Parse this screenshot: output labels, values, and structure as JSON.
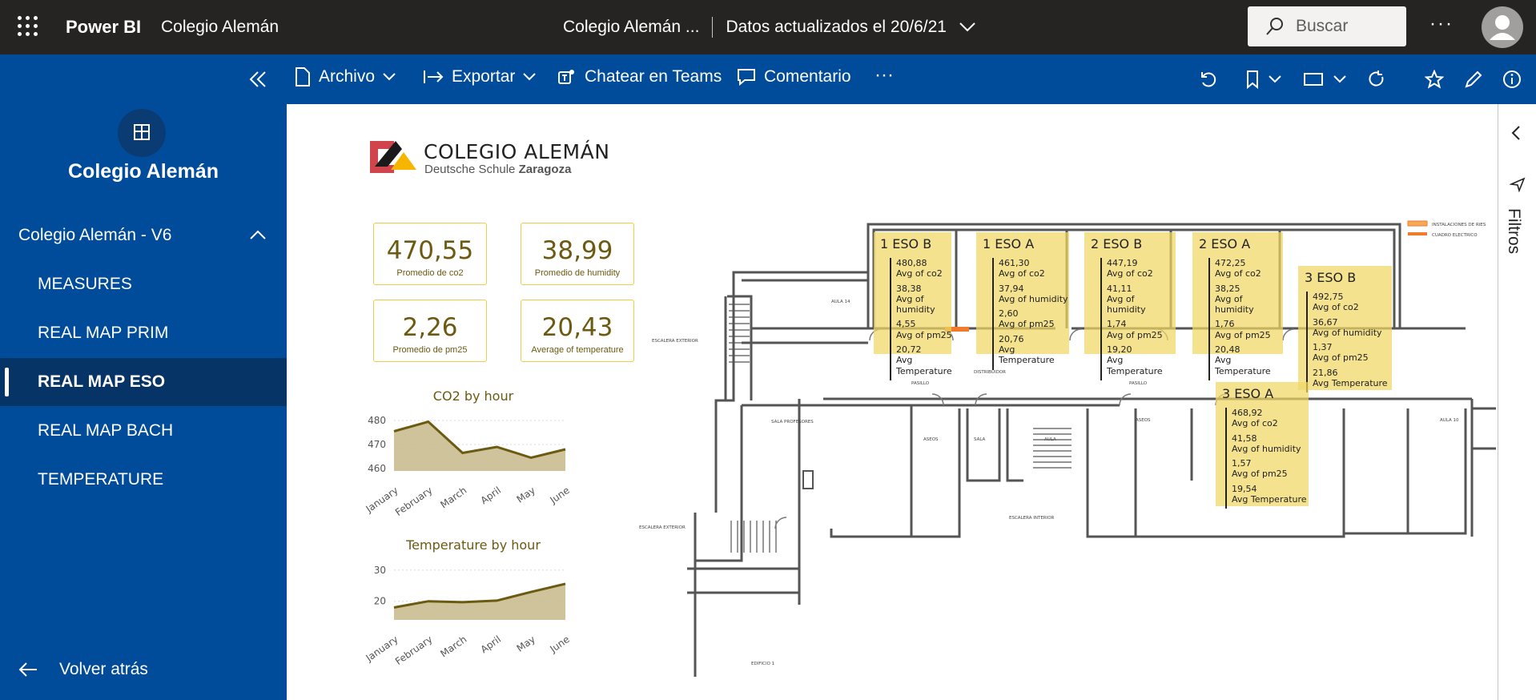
{
  "topbar": {
    "brand": "Power BI",
    "workspace": "Colegio Alemán",
    "report_title": "Colegio Alemán ...",
    "updated": "Datos actualizados el 20/6/21",
    "search_placeholder": "Buscar",
    "more": "···"
  },
  "toolbar": {
    "archivo": "Archivo",
    "exportar": "Exportar",
    "teams": "Chatear en Teams",
    "comentario": "Comentario",
    "more": "···"
  },
  "sidebar": {
    "workspace_title": "Colegio Alemán",
    "app_name": "Colegio Alemán - V6",
    "items": [
      {
        "label": "MEASURES"
      },
      {
        "label": "REAL MAP PRIM"
      },
      {
        "label": "REAL MAP ESO"
      },
      {
        "label": "REAL MAP BACH"
      },
      {
        "label": "TEMPERATURE"
      }
    ],
    "active_index": 2,
    "back": "Volver atrás"
  },
  "right_pane": {
    "filters": "Filtros"
  },
  "logo": {
    "line1": "COLEGIO ALEMÁN",
    "line2a": "Deutsche Schule",
    "line2b": "Zaragoza"
  },
  "cards": [
    {
      "value": "470,55",
      "label": "Promedio de co2"
    },
    {
      "value": "38,99",
      "label": "Promedio de humidity"
    },
    {
      "value": "2,26",
      "label": "Promedio de pm25"
    },
    {
      "value": "20,43",
      "label": "Average of temperature"
    }
  ],
  "chart_data": [
    {
      "type": "area",
      "title": "CO2 by hour",
      "categories": [
        "January",
        "February",
        "March",
        "April",
        "May",
        "June"
      ],
      "series": [
        {
          "values": [
            475.5,
            479.5,
            466.5,
            469,
            464.5,
            468
          ]
        }
      ],
      "yticks": [
        460,
        470,
        480
      ],
      "ylim": [
        459,
        481
      ],
      "grid": true,
      "colors": {
        "fill": "#c9bc8f",
        "line": "#6b5a10"
      }
    },
    {
      "type": "area",
      "title": "Temperature by hour",
      "categories": [
        "January",
        "February",
        "March",
        "April",
        "May",
        "June"
      ],
      "series": [
        {
          "values": [
            18,
            20,
            19.7,
            20.2,
            23,
            25.6
          ]
        }
      ],
      "yticks": [
        20,
        30
      ],
      "ylim": [
        14,
        31
      ],
      "grid": true,
      "colors": {
        "fill": "#c9bc8f",
        "line": "#6b5a10"
      }
    }
  ],
  "rooms": [
    {
      "name": "1 ESO B",
      "co2": "480,88",
      "humidity": "38,38",
      "pm25": "4,55",
      "temp": "20,72"
    },
    {
      "name": "1 ESO A",
      "co2": "461,30",
      "humidity": "37,94",
      "pm25": "2,60",
      "temp": "20,76"
    },
    {
      "name": "2 ESO B",
      "co2": "447,19",
      "humidity": "41,11",
      "pm25": "1,74",
      "temp": "19,20"
    },
    {
      "name": "2 ESO A",
      "co2": "472,25",
      "humidity": "38,25",
      "pm25": "1,76",
      "temp": "20,48"
    },
    {
      "name": "3 ESO B",
      "co2": "492,75",
      "humidity": "36,67",
      "pm25": "1,37",
      "temp": "21,86"
    },
    {
      "name": "3 ESO A",
      "co2": "468,92",
      "humidity": "41,58",
      "pm25": "1,57",
      "temp": "19,54"
    }
  ],
  "room_labels": {
    "co2": "Avg of co2",
    "humidity": "Avg of humidity",
    "pm25": "Avg of pm25",
    "temp": "Avg Temperature"
  },
  "map_legend": [
    "INSTALACIONES DE RIES",
    "CUADRO ELECTRICO"
  ],
  "colors": {
    "topbar": "#252423",
    "brand_blue": "#004b9a",
    "active_nav": "#063466",
    "card_border": "#f0cb45",
    "room_fill": "#f0d764",
    "value_text": "#6b5a10"
  }
}
